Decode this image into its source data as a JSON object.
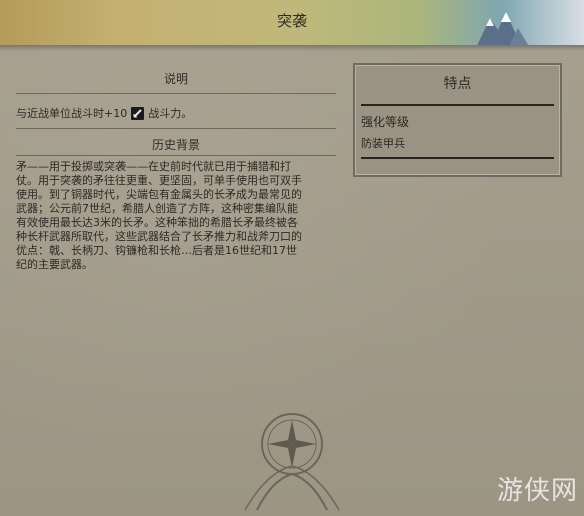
{
  "header": {
    "title": "突袭"
  },
  "description": {
    "heading": "说明",
    "text_before": "与近战单位战斗时+10",
    "icon": "sword-icon",
    "text_after": "战斗力。"
  },
  "history": {
    "heading": "历史背景",
    "lines": [
      "矛——用于投掷或突袭——在史前时代就已用于捕猎和打",
      "仗。用于突袭的矛往往更重、更坚固，可单手使用也可双手",
      "使用。到了铜器时代，尖端包有金属头的长矛成为最常见的",
      "武器；公元前7世纪，希腊人创造了方阵，这种密集编队能",
      "有效使用最长达3米的长矛。这种笨拙的希腊长矛最终被各",
      "种长杆武器所取代，这些武器结合了长矛推力和战斧刀口的",
      "优点：戟、长柄刀、钩镰枪和长枪…后者是16世纪和17世",
      "纪的主要武器。"
    ]
  },
  "traits": {
    "heading": "特点",
    "label": "强化等级",
    "value": "防装甲兵"
  },
  "watermark": "游侠网",
  "colors": {
    "accent_map": "#c4b071",
    "panel_bg": "#a39c8c"
  }
}
